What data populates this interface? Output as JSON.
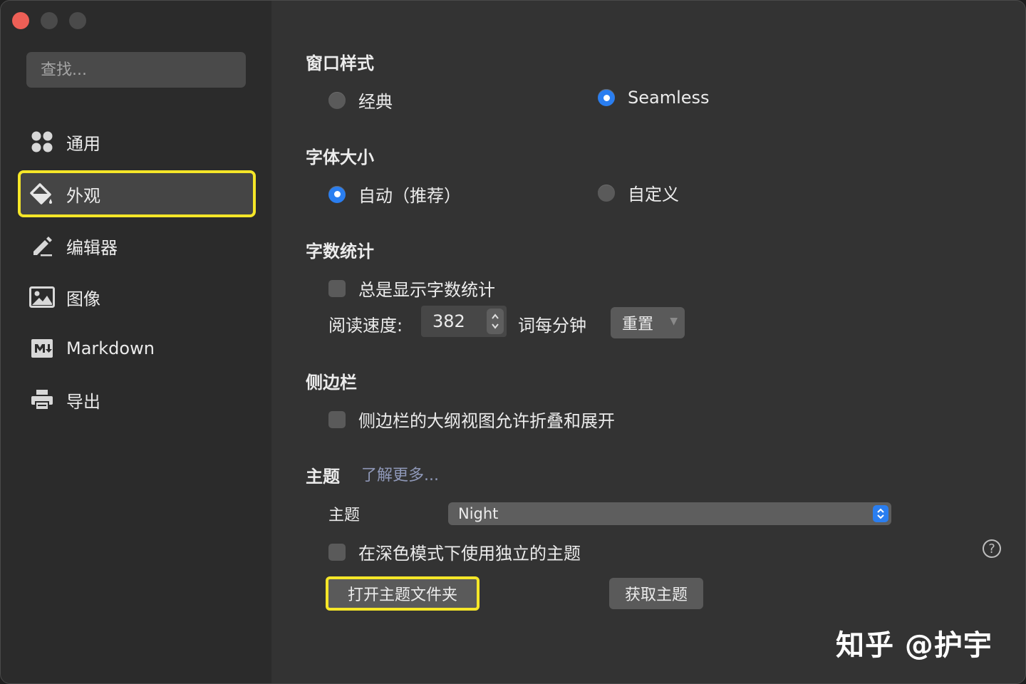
{
  "sidebar": {
    "search_placeholder": "查找...",
    "items": [
      {
        "label": "通用",
        "icon": "grid-icon"
      },
      {
        "label": "外观",
        "icon": "paint-bucket-icon"
      },
      {
        "label": "编辑器",
        "icon": "pencil-icon"
      },
      {
        "label": "图像",
        "icon": "image-icon"
      },
      {
        "label": "Markdown",
        "icon": "markdown-icon"
      },
      {
        "label": "导出",
        "icon": "printer-icon"
      }
    ],
    "active_index": 1
  },
  "window_style": {
    "title": "窗口样式",
    "options": [
      {
        "label": "经典",
        "selected": false
      },
      {
        "label": "Seamless",
        "selected": true
      }
    ]
  },
  "font_size": {
    "title": "字体大小",
    "options": [
      {
        "label": "自动（推荐）",
        "selected": true
      },
      {
        "label": "自定义",
        "selected": false
      }
    ]
  },
  "word_count": {
    "title": "字数统计",
    "always_show_label": "总是显示字数统计",
    "reading_speed_label": "阅读速度:",
    "reading_speed_value": "382",
    "unit_label": "词每分钟",
    "reset_label": "重置"
  },
  "sidebar_section": {
    "title": "侧边栏",
    "outline_collapse_label": "侧边栏的大纲视图允许折叠和展开"
  },
  "theme": {
    "title": "主题",
    "learn_more": "了解更多...",
    "theme_label": "主题",
    "theme_value": "Night",
    "dark_mode_label": "在深色模式下使用独立的主题",
    "open_folder_label": "打开主题文件夹",
    "get_themes_label": "获取主题",
    "help_glyph": "?"
  },
  "watermark": "知乎 @护宇",
  "colors": {
    "accent": "#2a7ef0",
    "highlight": "#f5e628",
    "close": "#ed5f56"
  }
}
